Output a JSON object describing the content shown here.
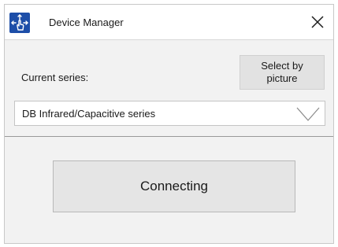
{
  "window": {
    "title": "Device Manager"
  },
  "series": {
    "label": "Current series:",
    "select_by_picture_label": "Select by\npicture",
    "selected_value": "DB Infrared/Capacitive series"
  },
  "action": {
    "connect_label": "Connecting"
  },
  "icons": {
    "app": "touch-hand-icon",
    "close": "close-icon",
    "dropdown": "chevron-down-icon"
  },
  "colors": {
    "accent": "#1d4ea8",
    "background": "#f2f2f2",
    "button": "#e5e5e5"
  }
}
